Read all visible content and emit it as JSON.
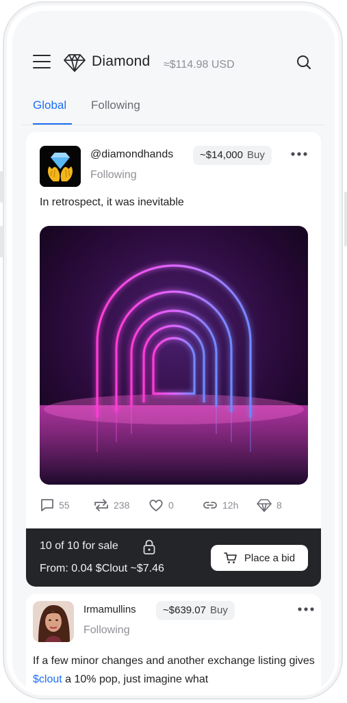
{
  "header": {
    "brand": "Diamond",
    "balance": "≈$114.98 USD"
  },
  "tabs": [
    {
      "label": "Global",
      "active": true
    },
    {
      "label": "Following",
      "active": false
    }
  ],
  "posts": [
    {
      "username": "@diamondhands",
      "price": "~$14,000",
      "buy_label": "Buy",
      "follow_status": "Following",
      "text": "In retrospect, it was inevitable",
      "stats": {
        "comments": "55",
        "reposts": "238",
        "likes": "0",
        "age": "12h",
        "diamonds": "8"
      },
      "sale": {
        "count": "10 of 10 for sale",
        "from": "From: 0.04 $Clout  ~$7.46",
        "bid_label": "Place a bid"
      }
    },
    {
      "username": "Irmamullins",
      "price": "~$639.07",
      "buy_label": "Buy",
      "follow_status": "Following",
      "text_before": "If a few minor changes and another exchange listing gives ",
      "text_link": "$clout",
      "text_after": " a 10% pop, just imagine what"
    }
  ],
  "colors": {
    "accent": "#1b6ef3",
    "sale_bar": "#232529",
    "background": "#f6f7f9"
  },
  "icons": [
    "menu-icon",
    "diamond-logo-icon",
    "search-icon",
    "comment-icon",
    "repost-icon",
    "heart-icon",
    "link-icon",
    "diamond-icon",
    "lock-icon",
    "cart-icon",
    "more-icon"
  ]
}
